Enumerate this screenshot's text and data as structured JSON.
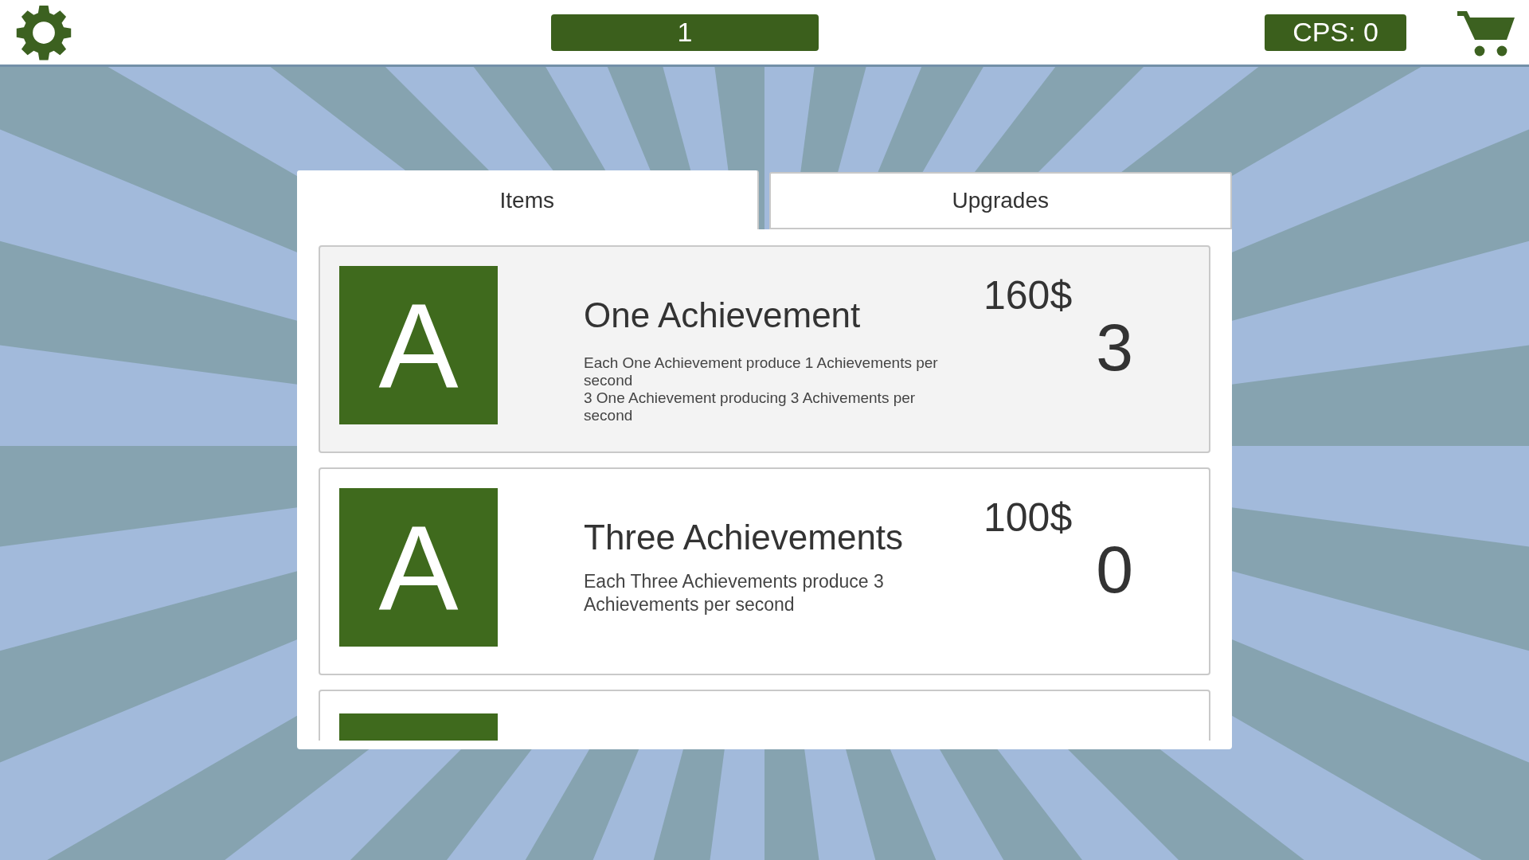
{
  "top_bar": {
    "counter": "1",
    "cps": "CPS: 0"
  },
  "tabs": [
    {
      "label": "Items",
      "selected": true
    },
    {
      "label": "Upgrades",
      "selected": false
    }
  ],
  "items": [
    {
      "kind": "full",
      "selected": true,
      "icon_letter": "A",
      "name": "One Achievement",
      "price": "160$",
      "count": "3",
      "description": [
        "Each One Achievement  produce 1 Achievements per second",
        "3 One Achievement  producing 3 Achivements per second"
      ]
    },
    {
      "kind": "full",
      "selected": false,
      "icon_letter": "A",
      "name": "Three Achievements",
      "price": "100$",
      "count": "0",
      "description": [
        "Each Three Achievements produce 3 Achievements per second"
      ]
    },
    {
      "kind": "partial",
      "selected": false
    }
  ]
}
